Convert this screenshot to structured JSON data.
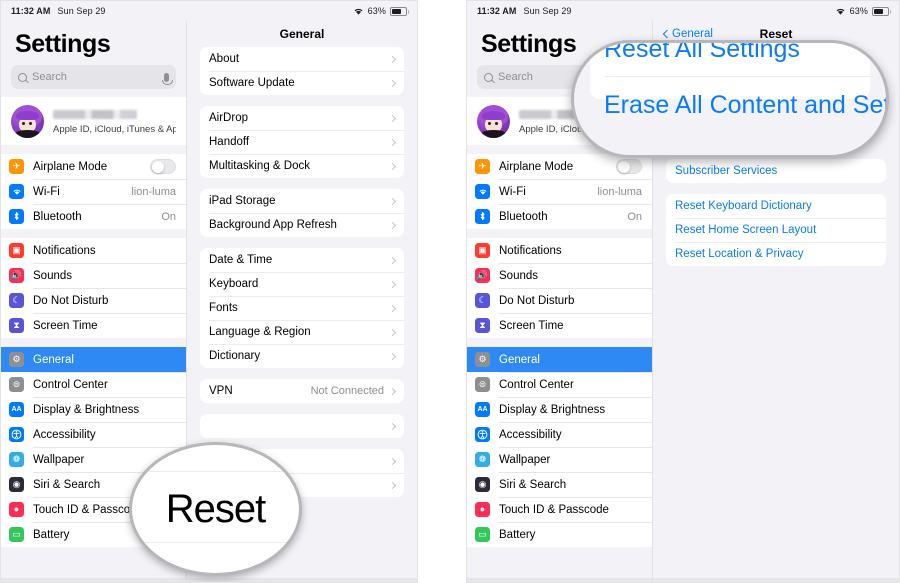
{
  "status_bar": {
    "time": "11:32 AM",
    "date": "Sun Sep 29",
    "battery_percent": "63%",
    "wifi_icon": "wifi-icon",
    "battery_icon": "battery-icon"
  },
  "sidebar": {
    "title": "Settings",
    "search_placeholder": "Search",
    "search_icon": "search-icon",
    "mic_icon": "microphone-icon",
    "account": {
      "name_redacted": "",
      "subtitle": "Apple ID, iCloud, iTunes & App St...",
      "avatar": "user-avatar"
    },
    "groups": [
      {
        "items": [
          {
            "label": "Airplane Mode",
            "icon": "airplane-icon",
            "color": "#ff9500",
            "glyph": "✈",
            "control": "toggle",
            "value": ""
          },
          {
            "label": "Wi-Fi",
            "icon": "wifi-icon",
            "color": "#007aff",
            "glyph": "◔",
            "control": "value",
            "value": "lion-luma"
          },
          {
            "label": "Bluetooth",
            "icon": "bluetooth-icon",
            "color": "#007aff",
            "glyph": "ᛦ",
            "control": "value",
            "value": "On"
          }
        ]
      },
      {
        "items": [
          {
            "label": "Notifications",
            "icon": "notifications-icon",
            "color": "#ff3b30",
            "glyph": "▣",
            "control": "none",
            "value": ""
          },
          {
            "label": "Sounds",
            "icon": "sounds-icon",
            "color": "#ff2d55",
            "glyph": "◀",
            "control": "none",
            "value": ""
          },
          {
            "label": "Do Not Disturb",
            "icon": "do-not-disturb-icon",
            "color": "#5856d6",
            "glyph": "☾",
            "control": "none",
            "value": ""
          },
          {
            "label": "Screen Time",
            "icon": "screen-time-icon",
            "color": "#5856d6",
            "glyph": "⧖",
            "control": "none",
            "value": ""
          }
        ]
      },
      {
        "items": [
          {
            "label": "General",
            "icon": "general-icon",
            "color": "#8e8e93",
            "glyph": "⚙",
            "control": "none",
            "value": "",
            "selected": true
          },
          {
            "label": "Control Center",
            "icon": "control-center-icon",
            "color": "#8e8e93",
            "glyph": "☷",
            "control": "none",
            "value": ""
          },
          {
            "label": "Display & Brightness",
            "icon": "display-brightness-icon",
            "color": "#007aff",
            "glyph": "AA",
            "control": "none",
            "value": ""
          },
          {
            "label": "Accessibility",
            "icon": "accessibility-icon",
            "color": "#007aff",
            "glyph": "Ⓙ",
            "control": "none",
            "value": ""
          },
          {
            "label": "Wallpaper",
            "icon": "wallpaper-icon",
            "color": "#32ade6",
            "glyph": "❁",
            "control": "none",
            "value": ""
          },
          {
            "label": "Siri & Search",
            "icon": "siri-search-icon",
            "color": "#2b2b3a",
            "glyph": "◉",
            "control": "none",
            "value": ""
          },
          {
            "label": "Touch ID & Passcode",
            "icon": "touch-id-passcode-icon",
            "color": "#ff2d55",
            "glyph": "●",
            "control": "none",
            "value": ""
          },
          {
            "label": "Battery",
            "icon": "battery-icon",
            "color": "#34c759",
            "glyph": "▭",
            "control": "none",
            "value": ""
          }
        ]
      }
    ]
  },
  "left_panel": {
    "nav_title": "General",
    "groups": [
      {
        "rows": [
          {
            "label": "About",
            "value": ""
          },
          {
            "label": "Software Update",
            "value": ""
          }
        ]
      },
      {
        "rows": [
          {
            "label": "AirDrop",
            "value": ""
          },
          {
            "label": "Handoff",
            "value": ""
          },
          {
            "label": "Multitasking & Dock",
            "value": ""
          }
        ]
      },
      {
        "rows": [
          {
            "label": "iPad Storage",
            "value": ""
          },
          {
            "label": "Background App Refresh",
            "value": ""
          }
        ]
      },
      {
        "rows": [
          {
            "label": "Date & Time",
            "value": ""
          },
          {
            "label": "Keyboard",
            "value": ""
          },
          {
            "label": "Fonts",
            "value": ""
          },
          {
            "label": "Language & Region",
            "value": ""
          },
          {
            "label": "Dictionary",
            "value": ""
          }
        ]
      },
      {
        "rows": [
          {
            "label": "VPN",
            "value": "Not Connected"
          }
        ]
      },
      {
        "rows": [
          {
            "label": "",
            "value": ""
          }
        ]
      },
      {
        "rows": [
          {
            "label": "",
            "value": ""
          },
          {
            "label": "",
            "value": ""
          }
        ]
      }
    ],
    "magnifier": {
      "text": "Reset",
      "shape": "circle"
    }
  },
  "right_panel": {
    "nav_back": "General",
    "nav_title": "Reset",
    "groups": [
      {
        "rows": [
          {
            "label": "Subscriber Services",
            "link": true
          }
        ]
      },
      {
        "rows": [
          {
            "label": "Reset Keyboard Dictionary",
            "link": true
          },
          {
            "label": "Reset Home Screen Layout",
            "link": true
          },
          {
            "label": "Reset Location & Privacy",
            "link": true
          }
        ]
      }
    ],
    "magnifier": {
      "shape": "pill",
      "rows": [
        "Reset All Settings",
        "Erase All Content and Settings"
      ]
    }
  },
  "colors": {
    "accent_blue": "#0a7bff",
    "selected_row": "#2f89f5",
    "background": "#f2f2f7",
    "card": "#ffffff",
    "magnifier_border": "#b7b7bb"
  }
}
